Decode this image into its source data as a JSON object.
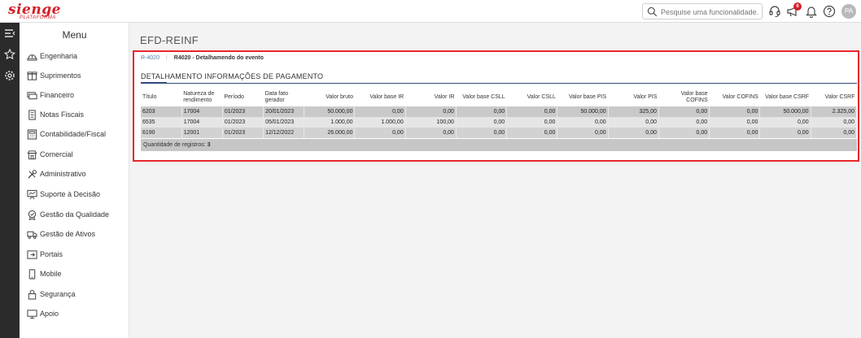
{
  "brand": {
    "name": "sienge",
    "sub": "PLATAFORMA"
  },
  "search": {
    "placeholder": "Pesquise uma funcionalidade."
  },
  "notifications": {
    "count": "6"
  },
  "user": {
    "initials": "PA"
  },
  "menu": {
    "title": "Menu",
    "items": [
      {
        "label": "Engenharia",
        "icon": "helmet-icon"
      },
      {
        "label": "Suprimentos",
        "icon": "box-icon"
      },
      {
        "label": "Financeiro",
        "icon": "cash-icon"
      },
      {
        "label": "Notas Fiscais",
        "icon": "receipt-icon"
      },
      {
        "label": "Contabilidade/Fiscal",
        "icon": "calculator-icon"
      },
      {
        "label": "Comercial",
        "icon": "shop-icon"
      },
      {
        "label": "Administrativo",
        "icon": "tools-icon"
      },
      {
        "label": "Suporte à Decisão",
        "icon": "presentation-icon"
      },
      {
        "label": "Gestão da Qualidade",
        "icon": "seal-icon"
      },
      {
        "label": "Gestão de Ativos",
        "icon": "truck-icon"
      },
      {
        "label": "Portais",
        "icon": "portal-icon"
      },
      {
        "label": "Mobile",
        "icon": "phone-icon"
      },
      {
        "label": "Segurança",
        "icon": "lock-icon"
      },
      {
        "label": "Apoio",
        "icon": "monitor-icon"
      }
    ]
  },
  "page": {
    "title": "EFD-REINF",
    "breadcrumb": {
      "link": "R-4020",
      "current": "R4020 - Detalhamendo do evento"
    },
    "section_title": "DETALHAMENTO INFORMAÇÕES DE PAGAMENTO"
  },
  "table": {
    "headers": [
      "Título",
      "Natureza de rendimento",
      "Período",
      "Data fato gerador",
      "Valor bruto",
      "Valor base IR",
      "Valor IR",
      "Valor base CSLL",
      "Valor CSLL",
      "Valor base PIS",
      "Valor PIS",
      "Valor base COFINS",
      "Valor COFINS",
      "Valor base CSRF",
      "Valor CSRF"
    ],
    "rows": [
      [
        "6203",
        "17004",
        "01/2023",
        "20/01/2023",
        "50.000,00",
        "0,00",
        "0,00",
        "0,00",
        "0,00",
        "50.000,00",
        "325,00",
        "0,00",
        "0,00",
        "50.000,00",
        "2.325,00"
      ],
      [
        "6535",
        "17004",
        "01/2023",
        "05/01/2023",
        "1.000,00",
        "1.000,00",
        "100,00",
        "0,00",
        "0,00",
        "0,00",
        "0,00",
        "0,00",
        "0,00",
        "0,00",
        "0,00"
      ],
      [
        "6190",
        "12001",
        "01/2023",
        "12/12/2022",
        "26.000,00",
        "0,00",
        "0,00",
        "0,00",
        "0,00",
        "0,00",
        "0,00",
        "0,00",
        "0,00",
        "0,00",
        "0,00"
      ]
    ],
    "footer_label": "Quantidade de registros:",
    "footer_count": "3"
  },
  "colors": {
    "brand": "#d31f26",
    "highlight_border": "#e8262b",
    "rail": "#2b2b2b",
    "section_rule": "#2f4a7a"
  }
}
